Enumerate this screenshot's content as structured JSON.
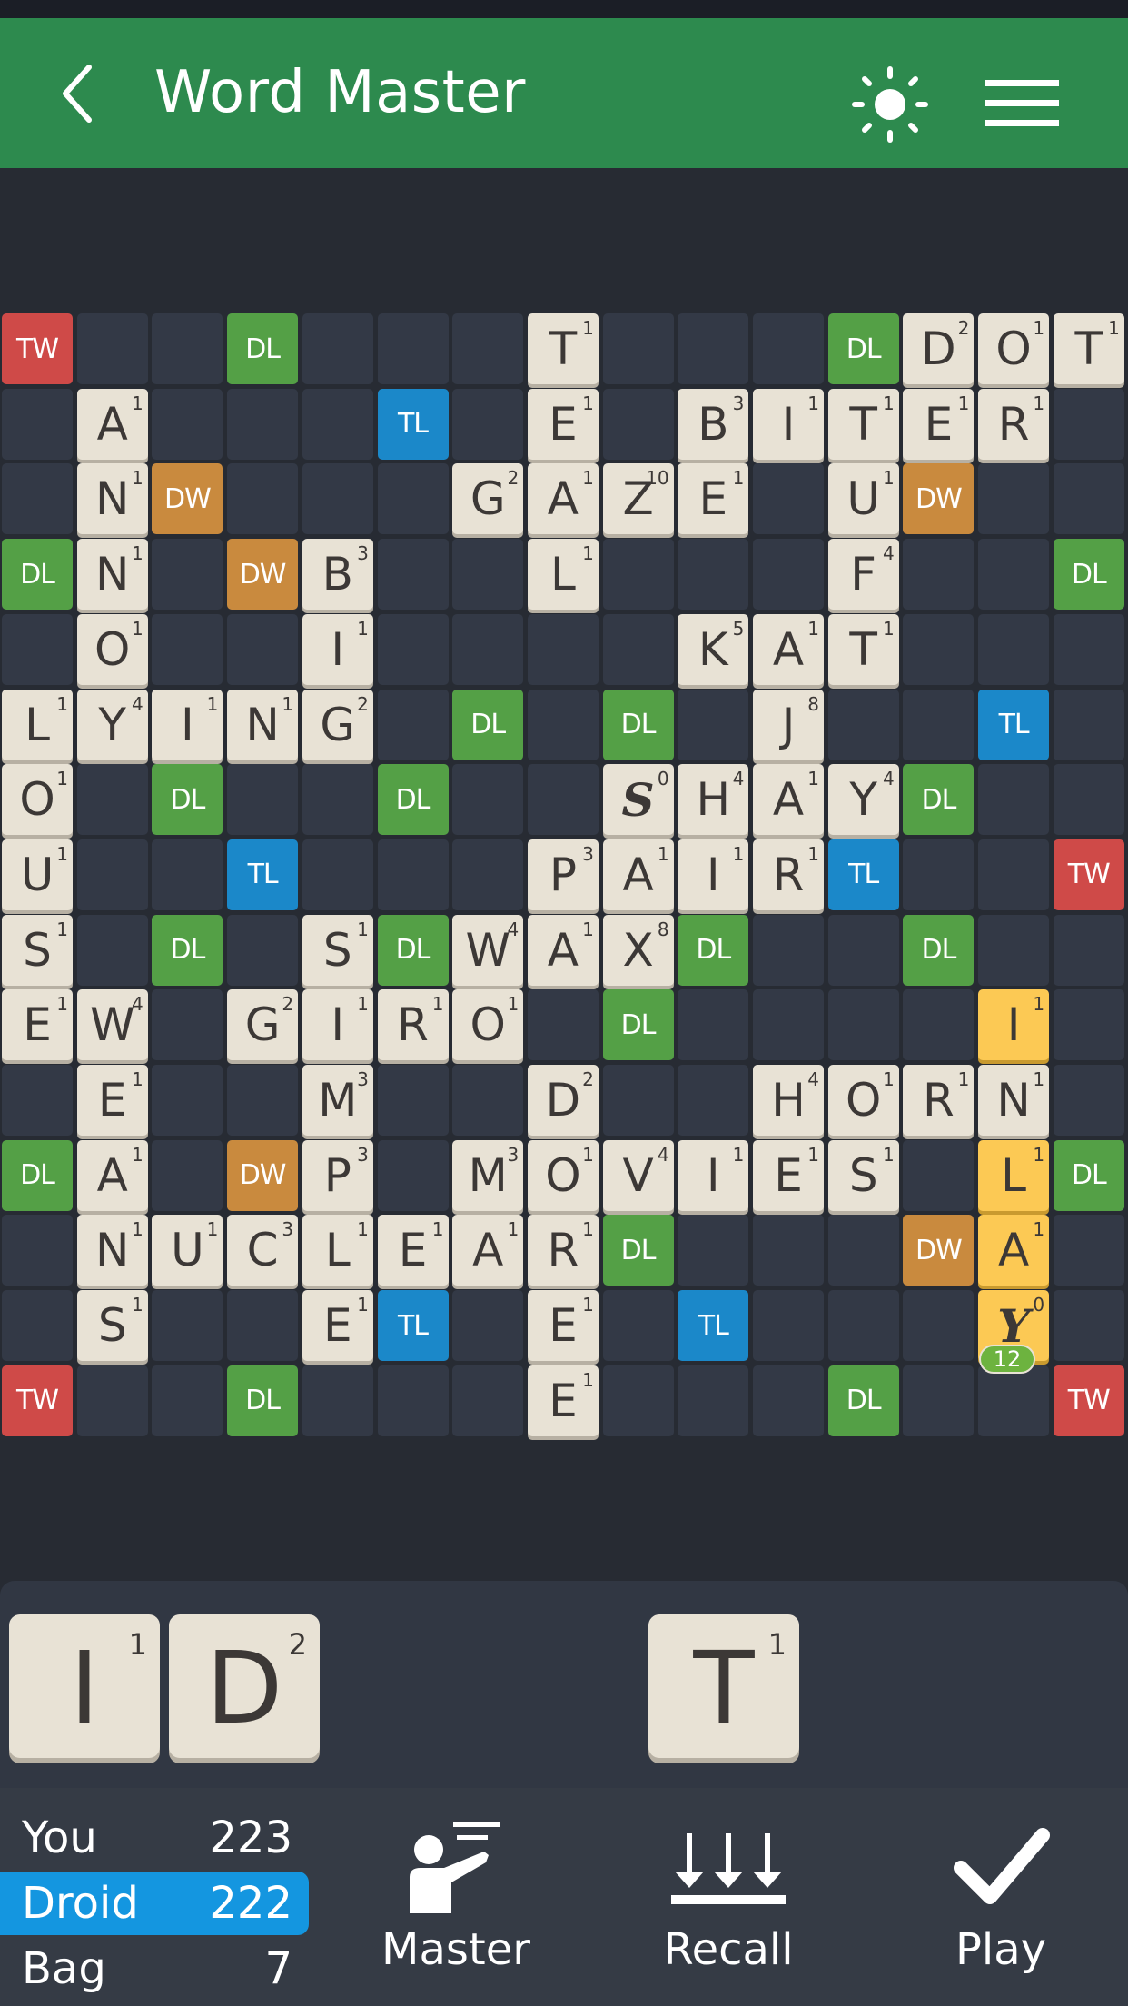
{
  "app": {
    "title": "Word Master",
    "icons": {
      "back": "chevron-left-icon",
      "theme": "sun-icon",
      "menu": "hamburger-menu-icon"
    }
  },
  "colors": {
    "appbar": "#2d8a4e",
    "background": "#272b33",
    "empty_cell": "#333946",
    "triple_word": "#cf4a48",
    "double_word": "#c98a3e",
    "triple_letter": "#1b88c9",
    "double_letter": "#54a046",
    "tile": "#e8e2d5",
    "new_tile": "#fcc954",
    "active_player": "#1496e0"
  },
  "board": {
    "size": 15,
    "premium_labels": {
      "TW": "TW",
      "DW": "DW",
      "TL": "TL",
      "DL": "DL"
    },
    "rows": [
      [
        "TW",
        "",
        "",
        "DL",
        "",
        "",
        "",
        "T1",
        "",
        "",
        "",
        "DL",
        "D2",
        "O1",
        "T1"
      ],
      [
        "",
        "A1",
        "",
        "",
        "",
        "TL",
        "",
        "E1",
        "",
        "B3",
        "I1",
        "T1",
        "E1",
        "R1",
        ""
      ],
      [
        "",
        "N1",
        "DW",
        "",
        "",
        "",
        "G2",
        "A1",
        "Z10",
        "E1",
        "",
        "U1",
        "DW",
        "",
        ""
      ],
      [
        "DL",
        "N1",
        "",
        "DW",
        "B3",
        "",
        "",
        "L1",
        "",
        "",
        "",
        "F4",
        "",
        "",
        "DL"
      ],
      [
        "",
        "O1",
        "",
        "",
        "I1",
        "",
        "",
        "",
        "",
        "K5",
        "A1",
        "T1",
        "",
        "",
        ""
      ],
      [
        "L1",
        "Y4",
        "I1",
        "N1",
        "G2",
        "",
        "DL",
        "",
        "DL",
        "",
        "J8",
        "",
        "",
        "TL",
        ""
      ],
      [
        "O1",
        "",
        "DL",
        "",
        "",
        "DL",
        "",
        "",
        "*S0",
        "H4",
        "A1",
        "Y4",
        "DL",
        "",
        ""
      ],
      [
        "U1",
        "",
        "",
        "TL",
        "",
        "",
        "",
        "P3",
        "A1",
        "I1",
        "R1",
        "TL",
        "",
        "",
        "TW"
      ],
      [
        "S1",
        "",
        "DL",
        "",
        "S1",
        "DL",
        "W4",
        "A1",
        "X8",
        "DL",
        "",
        "",
        "DL",
        "",
        ""
      ],
      [
        "E1",
        "W4",
        "",
        "G2",
        "I1",
        "R1",
        "O1",
        "",
        "DL",
        "",
        "",
        "",
        "",
        "+I1",
        ""
      ],
      [
        "",
        "E1",
        "",
        "",
        "M3",
        "",
        "",
        "D2",
        "",
        "",
        "H4",
        "O1",
        "R1",
        "N1",
        ""
      ],
      [
        "DL",
        "A1",
        "",
        "DW",
        "P3",
        "",
        "M3",
        "O1",
        "V4",
        "I1",
        "E1",
        "S1",
        "",
        "+L1",
        "DL"
      ],
      [
        "",
        "N1",
        "U1",
        "C3",
        "L1",
        "E1",
        "A1",
        "R1",
        "DL",
        "",
        "",
        "",
        "DW",
        "+A1",
        ""
      ],
      [
        "",
        "S1",
        "",
        "",
        "E1",
        "TL",
        "",
        "E1",
        "",
        "TL",
        "",
        "",
        "",
        "+*Y0",
        ""
      ],
      [
        "TW",
        "",
        "",
        "DL",
        "",
        "",
        "",
        "E1",
        "",
        "",
        "",
        "DL",
        "",
        "",
        "TW"
      ]
    ],
    "legend": "Letter+points = placed tile; '+' prefix = tile placed this turn (highlighted); '*' prefix = blank tile",
    "move_score_preview": "12"
  },
  "rack": {
    "tiles": [
      {
        "letter": "I",
        "points": "1"
      },
      {
        "letter": "D",
        "points": "2"
      },
      null,
      null,
      {
        "letter": "T",
        "points": "1"
      },
      null,
      null
    ]
  },
  "scores": {
    "you": {
      "label": "You",
      "value": "223"
    },
    "droid": {
      "label": "Droid",
      "value": "222",
      "active": true
    },
    "bag": {
      "label": "Bag",
      "value": "7"
    }
  },
  "actions": {
    "master": {
      "label": "Master",
      "icon": "teacher-icon"
    },
    "recall": {
      "label": "Recall",
      "icon": "recall-arrows-icon"
    },
    "play": {
      "label": "Play",
      "icon": "checkmark-icon"
    }
  }
}
